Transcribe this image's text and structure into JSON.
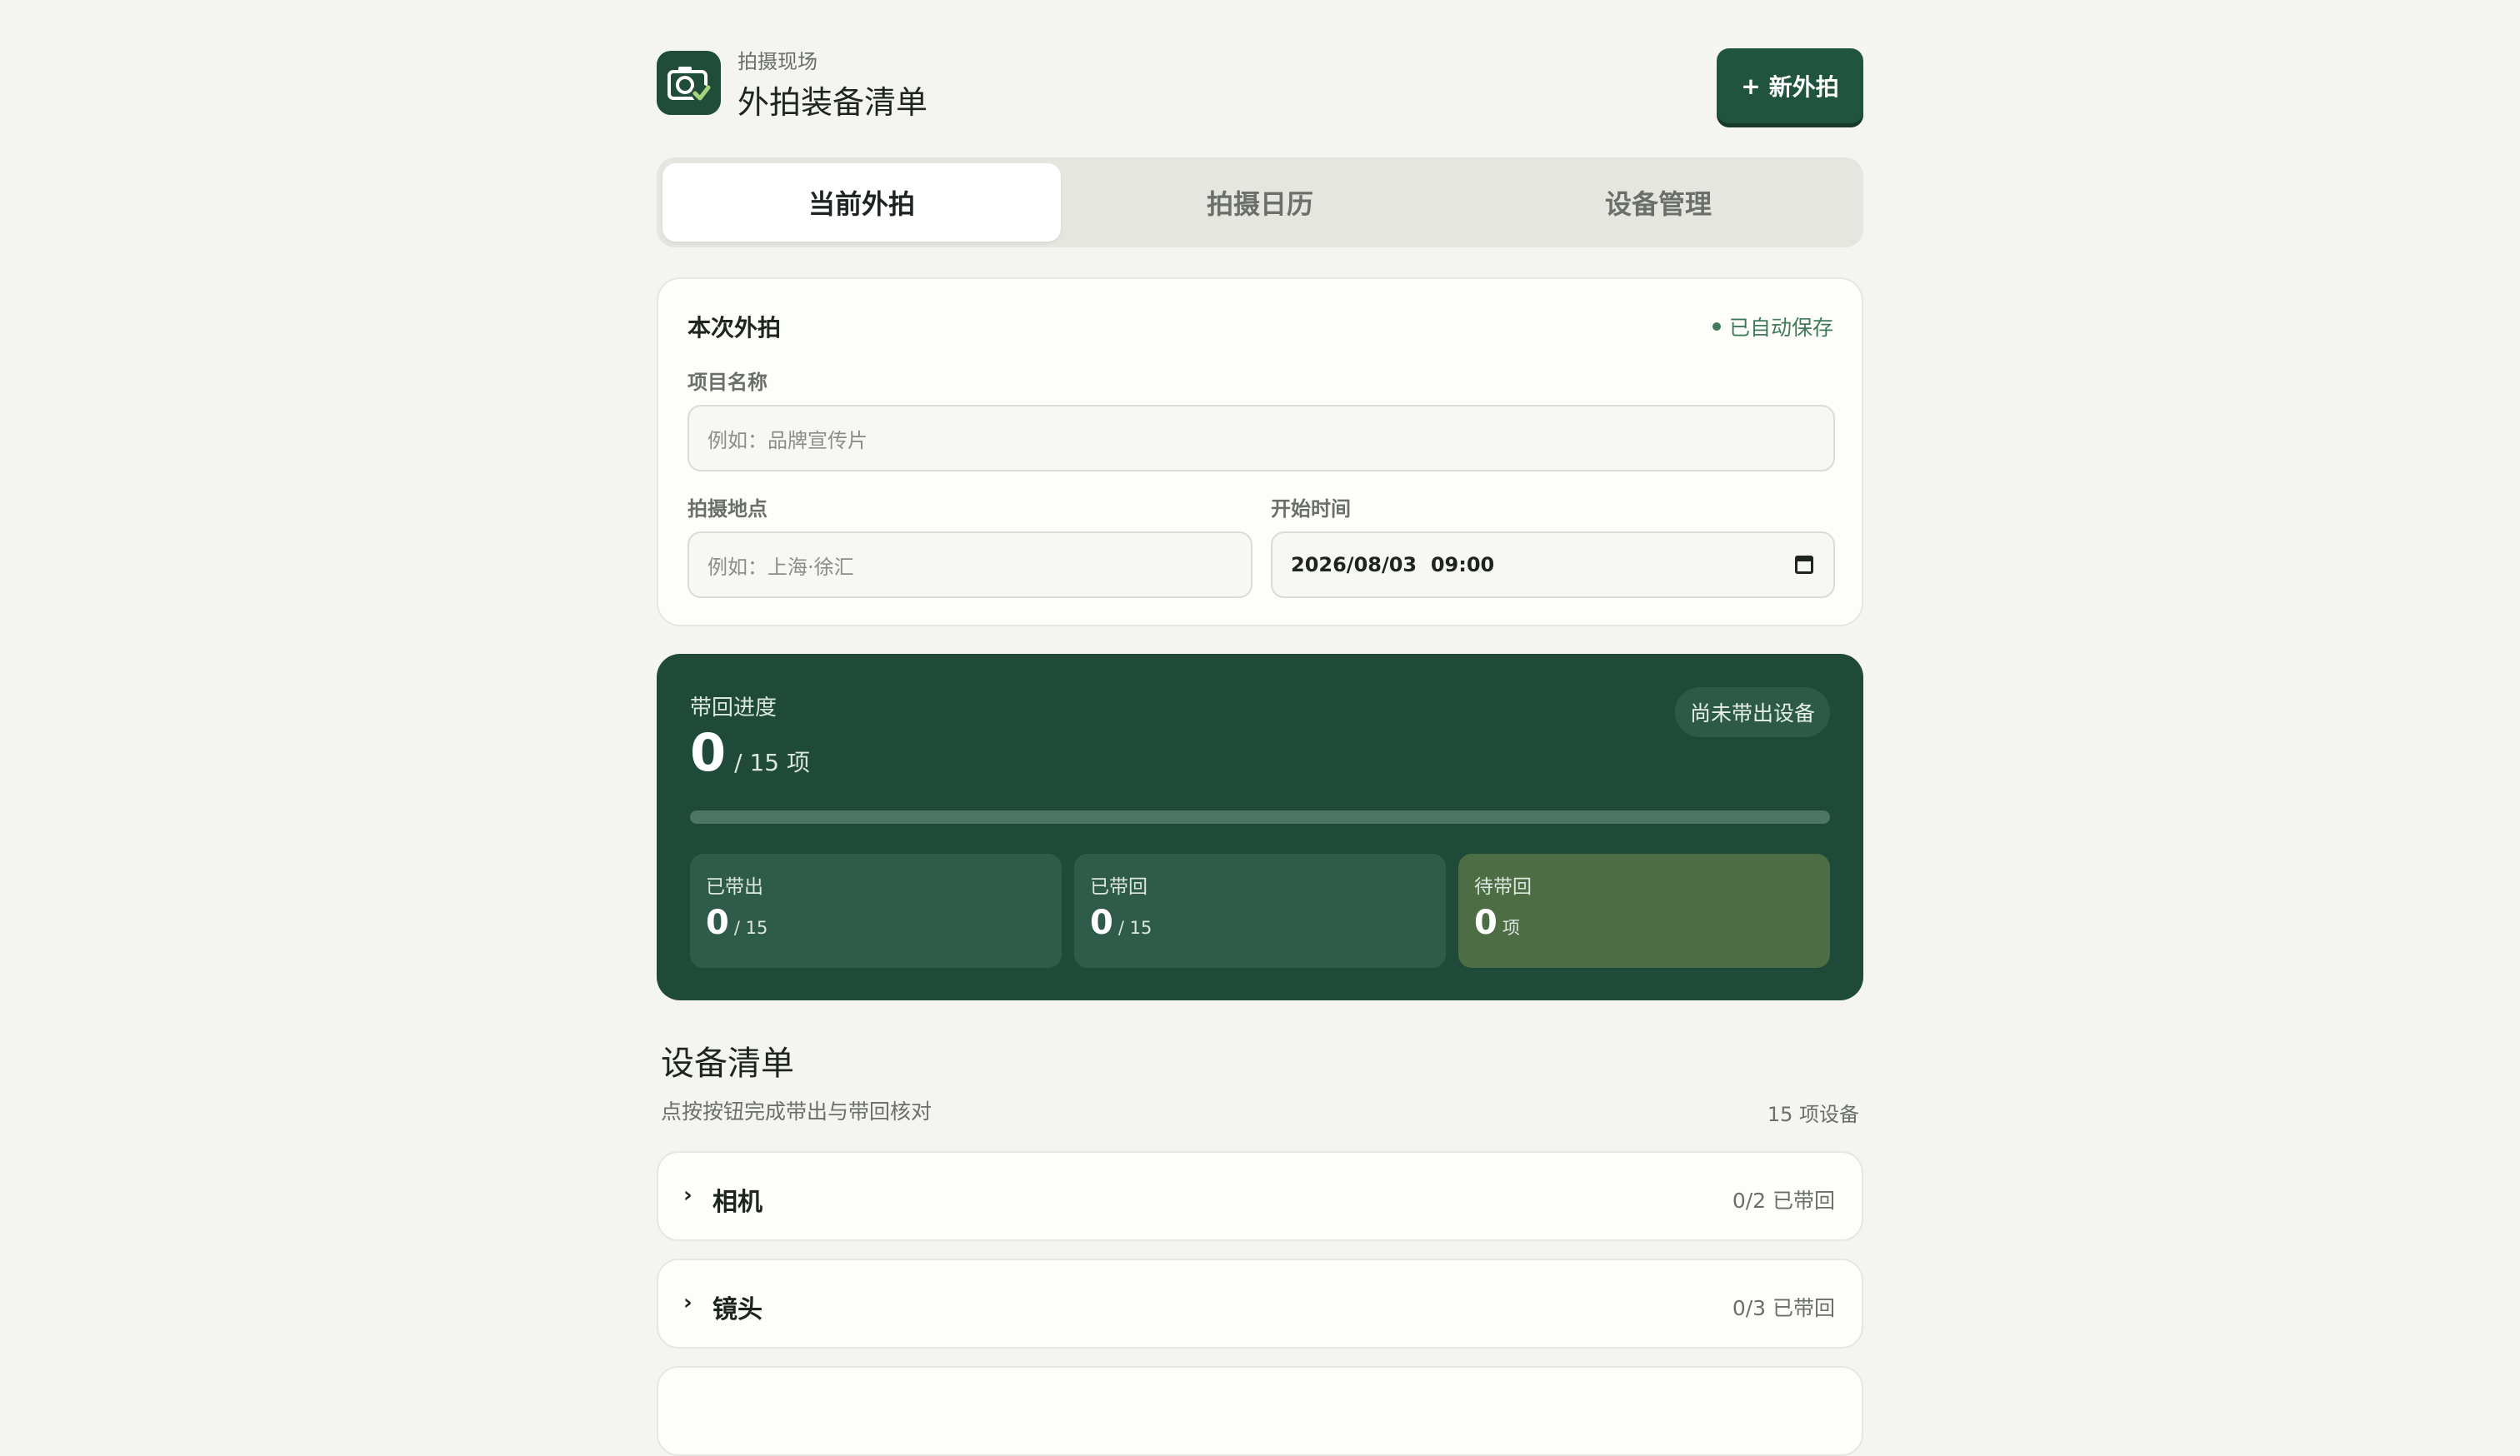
{
  "header": {
    "subtitle": "拍摄现场",
    "title": "外拍装备清单",
    "new_button_icon": "plus-icon",
    "new_button_label": "新外拍"
  },
  "tabs": [
    {
      "label": "当前外拍",
      "active": true
    },
    {
      "label": "拍摄日历",
      "active": false
    },
    {
      "label": "设备管理",
      "active": false
    }
  ],
  "form": {
    "title": "本次外拍",
    "autosave": "已自动保存",
    "project_label": "项目名称",
    "project_placeholder": "例如：品牌宣传片",
    "location_label": "拍摄地点",
    "location_placeholder": "例如：上海·徐汇",
    "start_label": "开始时间",
    "start_value": "2026/08/03  09:00"
  },
  "progress": {
    "label": "带回进度",
    "count": "0",
    "unit": "/ 15 项",
    "badge": "尚未带出设备",
    "fraction": 0,
    "stats": [
      {
        "label": "已带出",
        "value": "0",
        "unit": "/ 15"
      },
      {
        "label": "已带回",
        "value": "0",
        "unit": "/ 15"
      },
      {
        "label": "待带回",
        "value": "0",
        "unit": "项"
      }
    ]
  },
  "equipment": {
    "title": "设备清单",
    "subtitle": "点按按钮完成带出与带回核对",
    "count": "15 项设备",
    "categories": [
      {
        "name": "相机",
        "status": "0/2 已带回"
      },
      {
        "name": "镜头",
        "status": "0/3 已带回"
      }
    ]
  },
  "colors": {
    "brand": "#1f4d3a",
    "progress_bg": "#1f4a3a",
    "accent_pending": "#4d6e44",
    "autosave": "#3f7a5a"
  }
}
